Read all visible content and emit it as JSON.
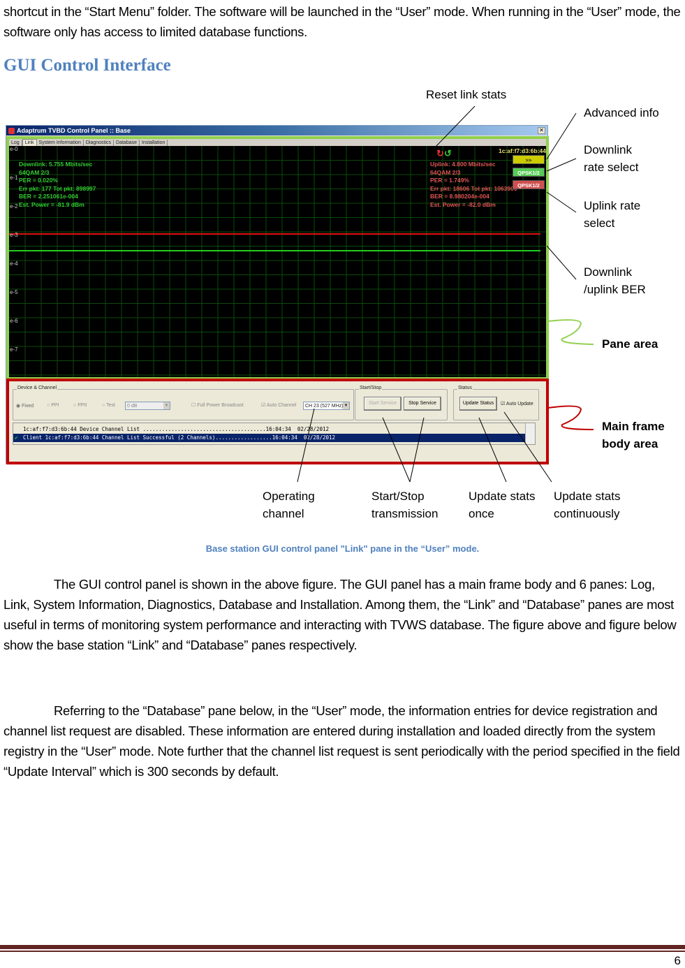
{
  "intro_text": "shortcut in the “Start Menu” folder. The software will be launched in the “User” mode. When running in the “User” mode, the software only has access to limited database functions.",
  "section_heading": "GUI Control Interface",
  "figure": {
    "window_title": "Adaptrum TVBD Control Panel :: Base",
    "tabs": [
      "Log",
      "Link",
      "System Information",
      "Diagnostics",
      "Database",
      "Installation"
    ],
    "active_tab": "Link",
    "graph": {
      "y_labels": [
        "e-0",
        "e-1",
        "e-2",
        "e-3",
        "e-4",
        "e-5",
        "e-6",
        "e-7"
      ],
      "downlink_stats": [
        "Downlink:  5.755 Mbits/sec",
        "64QAM  2/3",
        "PER = 0.020%",
        "Err pkt: 177 Tot pkt: 898997",
        "BER = 2.251061e-004",
        "Est. Power = -81.9 dBm"
      ],
      "uplink_stats": [
        "Uplink: 4.800 Mbits/sec",
        "64QAM  2/3",
        "PER = 1.749%",
        "Err pkt: 18606 Tot pkt: 1063900",
        "BER = 8.980204e-004",
        "Est. Power = -82.0 dBm"
      ],
      "mac_address": "1c:af:f7:d3:6b:44",
      "advanced_button": ">>",
      "downlink_rate": "QPSK1/2",
      "uplink_rate": "QPSK1/2",
      "colors": {
        "downlink": "#33cc33",
        "uplink": "#e05555",
        "advanced": "#cccc00",
        "downlink_rate_bg": "#55cc55",
        "uplink_rate_bg": "#d05050"
      }
    },
    "device_channel": {
      "title": "Device & Channel",
      "radios": [
        "Fixed",
        "PPI",
        "PPII",
        "Test"
      ],
      "selected_radio": "Fixed",
      "test_level": "0 dB",
      "full_power_label": "Full Power Broadcast",
      "auto_channel_label": "Auto Channel",
      "channel": "CH 23 (527 MHz)"
    },
    "start_stop": {
      "title": "Start/Stop",
      "start_label": "Start Service",
      "stop_label": "Stop Service"
    },
    "status": {
      "title": "Status",
      "update_label": "Update Status",
      "auto_update_label": "Auto Update"
    },
    "log_rows": [
      {
        "text": "1c:af:f7:d3:6b:44 Device Channel List .......................................16:04:34  02/28/2012",
        "selected": false
      },
      {
        "text": "Client 1c:af:f7:d3:6b:44 Channel List Successful (2 Channels)..................16:04:34  02/28/2012",
        "selected": true
      }
    ]
  },
  "annotations": {
    "reset": "Reset link stats",
    "advanced": "Advanced info",
    "downlink_rate": [
      "Downlink",
      "rate select"
    ],
    "uplink_rate": [
      "Uplink rate",
      "select"
    ],
    "ber": [
      "Downlink",
      "/uplink BER"
    ],
    "pane_area": "Pane area",
    "main_frame": [
      "Main frame",
      "body area"
    ],
    "operating_channel": [
      "Operating",
      "channel"
    ],
    "start_stop": [
      "Start/Stop",
      "transmission"
    ],
    "update_once": [
      "Update stats",
      "once"
    ],
    "update_continuous": [
      "Update stats",
      "continuously"
    ]
  },
  "caption": "Base station GUI control panel \"Link\" pane in the “User” mode.",
  "paragraph1": "The GUI control panel is shown in the above figure. The GUI panel has a main frame body and 6 panes: Log, Link, System Information, Diagnostics, Database and Installation. Among them, the “Link” and “Database” panes are most useful in terms of monitoring system performance and interacting with TVWS database. The figure above and figure below show the base station “Link” and “Database” panes respectively.",
  "paragraph2": "Referring to the “Database” pane below, in the “User” mode, the information entries for device registration and channel list request are disabled. These information are entered during installation and loaded directly from the system registry in the “User” mode. Note further that the channel list request is sent periodically with the period specified in the field “Update Interval” which is 300 seconds by default.",
  "page_number": "6"
}
